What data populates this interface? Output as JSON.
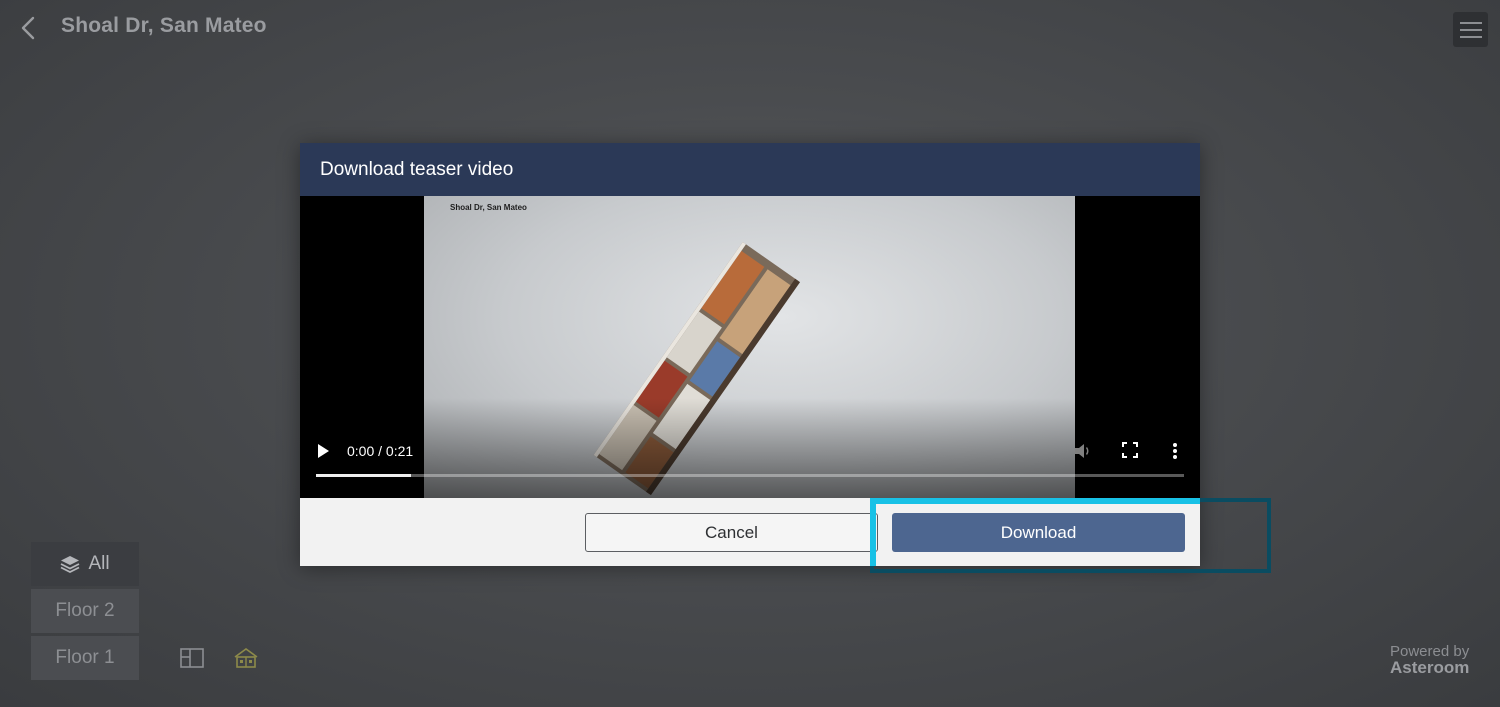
{
  "header": {
    "title": "Shoal Dr, San Mateo",
    "back_icon": "chevron-left-icon",
    "menu_icon": "hamburger-menu-icon"
  },
  "floors": {
    "items": [
      {
        "label": "All",
        "icon": "layers-icon",
        "active": true
      },
      {
        "label": "Floor 2",
        "active": false
      },
      {
        "label": "Floor 1",
        "active": false
      }
    ]
  },
  "view_toggle": {
    "floorplan_icon": "floorplan-icon",
    "dollhouse_icon": "dollhouse-icon"
  },
  "powered_by": {
    "text": "Powered by",
    "brand": "Asteroom"
  },
  "modal": {
    "title": "Download teaser video",
    "video": {
      "frame_title": "Shoal Dr, San Mateo",
      "time": "0:00 / 0:21",
      "progress_buffered": 0.11,
      "play_icon": "play-icon",
      "volume_icon": "volume-icon",
      "fullscreen_icon": "fullscreen-icon",
      "more_icon": "more-vertical-icon"
    },
    "cancel_label": "Cancel",
    "download_label": "Download"
  },
  "colors": {
    "modal_header": "#2b3957",
    "download_button": "#4d6690",
    "highlight_cyan": "#18c1e6",
    "highlight_dark": "#0a4c61"
  }
}
